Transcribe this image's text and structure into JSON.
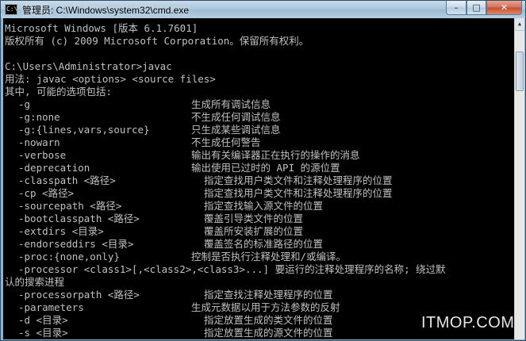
{
  "window": {
    "title": "管理员: C:\\Windows\\system32\\cmd.exe",
    "app_icon_text": "C:\\",
    "buttons": {
      "minimize": "–",
      "maximize": "□",
      "close": "✕"
    }
  },
  "console": {
    "header_lines": [
      "Microsoft Windows [版本 6.1.7601]",
      "版权所有 (c) 2009 Microsoft Corporation。保留所有权利。",
      "",
      "C:\\Users\\Administrator>javac",
      "用法: javac <options> <source files>",
      "其中, 可能的选项包括:"
    ],
    "options": [
      {
        "name": "-g",
        "desc": "生成所有调试信息",
        "col": 1
      },
      {
        "name": "-g:none",
        "desc": "不生成任何调试信息",
        "col": 1
      },
      {
        "name": "-g:{lines,vars,source}",
        "desc": "只生成某些调试信息",
        "col": 1
      },
      {
        "name": "-nowarn",
        "desc": "不生成任何警告",
        "col": 1
      },
      {
        "name": "-verbose",
        "desc": "输出有关编译器正在执行的操作的消息",
        "col": 1
      },
      {
        "name": "-deprecation",
        "desc": "输出使用已过时的 API 的源位置",
        "col": 1
      },
      {
        "name": "-classpath <路径>",
        "desc": "指定查找用户类文件和注释处理程序的位置",
        "col": 2
      },
      {
        "name": "-cp <路径>",
        "desc": "指定查找用户类文件和注释处理程序的位置",
        "col": 2
      },
      {
        "name": "-sourcepath <路径>",
        "desc": "指定查找输入源文件的位置",
        "col": 2
      },
      {
        "name": "-bootclasspath <路径>",
        "desc": "覆盖引导类文件的位置",
        "col": 2
      },
      {
        "name": "-extdirs <目录>",
        "desc": "覆盖所安装扩展的位置",
        "col": 2
      },
      {
        "name": "-endorseddirs <目录>",
        "desc": "覆盖签名的标准路径的位置",
        "col": 2
      },
      {
        "name": "-proc:{none,only}",
        "desc": "控制是否执行注释处理和/或编译。",
        "col": 1
      },
      {
        "name": "-processor <class1>[,<class2>,<class3>...] 要运行的注释处理程序的名称; 绕过默",
        "desc": "",
        "col": 0
      }
    ],
    "wrap_line": "认的搜索进程",
    "options_after": [
      {
        "name": "-processorpath <路径>",
        "desc": "指定查找注释处理程序的位置",
        "col": 2
      },
      {
        "name": "-parameters",
        "desc": "生成元数据以用于方法参数的反射",
        "col": 1
      },
      {
        "name": "-d <目录>",
        "desc": "指定放置生成的类文件的位置",
        "col": 2
      },
      {
        "name": "-s <目录>",
        "desc": "指定放置生成的源文件的位置",
        "col": 2
      }
    ]
  },
  "watermark": "ITMOP.COM"
}
